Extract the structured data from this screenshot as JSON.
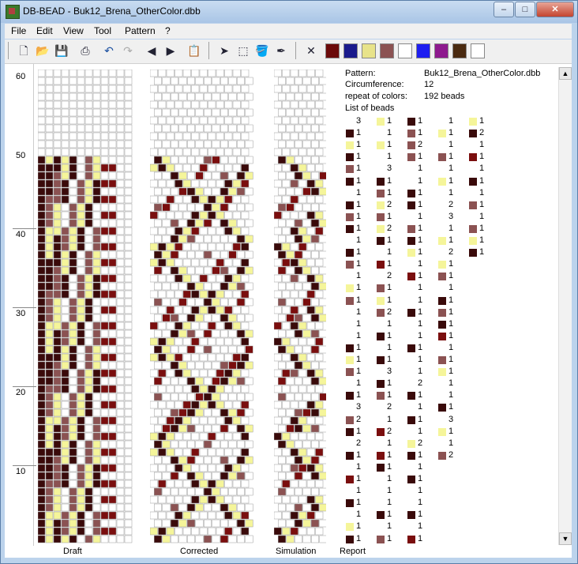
{
  "window": {
    "app": "DB-BEAD",
    "file": "Buk12_Brena_OtherColor.dbb",
    "title": "DB-BEAD - Buk12_Brena_OtherColor.dbb"
  },
  "menu": [
    "File",
    "Edit",
    "View",
    "Tool",
    "Pattern",
    "?"
  ],
  "toolbar_icons": [
    "new-file-icon",
    "open-folder-icon",
    "save-icon",
    "print-icon",
    "undo-icon",
    "redo-icon",
    "arrow-left-icon",
    "arrow-right-icon",
    "paste-icon",
    "pointer-icon",
    "select-rect-icon",
    "fill-icon",
    "eyedropper-icon",
    "clear-x-icon"
  ],
  "palette": [
    "#6b0a0a",
    "#1a1a8c",
    "#e8e38a",
    "#8b5252",
    "#ffffff",
    "#1e1ef0",
    "#8e1a8e",
    "#4a2a10",
    "#ffffff"
  ],
  "axis_labels": [
    "60",
    "50",
    "40",
    "30",
    "20",
    "10"
  ],
  "panels": [
    "Draft",
    "Corrected",
    "Simulation",
    "Report"
  ],
  "report": {
    "pattern_label": "Pattern:",
    "pattern_value": "Buk12_Brena_OtherColor.dbb",
    "circ_label": "Circumference:",
    "circ_value": "12",
    "repeat_label": "repeat of colors:",
    "repeat_value": "192 beads",
    "list_label": "List of beads"
  },
  "bead_colors": {
    "d": "#3a0a0a",
    "m": "#8b5252",
    "y": "#f5f59a",
    "w": "#ffffff",
    "r": "#7a0e0e"
  },
  "bead_list": [
    [
      [
        "w",
        "3"
      ],
      [
        "d",
        "1"
      ],
      [
        "y",
        "1"
      ],
      [
        "d",
        "1"
      ],
      [
        "m",
        "1"
      ],
      [
        "d",
        "1"
      ],
      [
        "w",
        "1"
      ],
      [
        "d",
        "1"
      ],
      [
        "m",
        "1"
      ],
      [
        "d",
        "1"
      ],
      [
        "w",
        "1"
      ],
      [
        "d",
        "1"
      ],
      [
        "m",
        "1"
      ],
      [
        "w",
        "1"
      ],
      [
        "y",
        "1"
      ],
      [
        "m",
        "1"
      ],
      [
        "w",
        "1"
      ],
      [
        "w",
        "1"
      ],
      [
        "w",
        "1"
      ],
      [
        "d",
        "1"
      ],
      [
        "y",
        "1"
      ],
      [
        "m",
        "1"
      ],
      [
        "w",
        "1"
      ],
      [
        "d",
        "1"
      ],
      [
        "w",
        "3"
      ],
      [
        "m",
        "2"
      ],
      [
        "d",
        "1"
      ],
      [
        "w",
        "2"
      ],
      [
        "d",
        "1"
      ],
      [
        "w",
        "1"
      ],
      [
        "r",
        "1"
      ],
      [
        "w",
        "1"
      ],
      [
        "d",
        "1"
      ],
      [
        "w",
        "1"
      ],
      [
        "y",
        "1"
      ],
      [
        "d",
        "1"
      ]
    ],
    [
      [
        "y",
        "1"
      ],
      [
        "w",
        "1"
      ],
      [
        "y",
        "1"
      ],
      [
        "w",
        "1"
      ],
      [
        "w",
        "3"
      ],
      [
        "d",
        "1"
      ],
      [
        "m",
        "1"
      ],
      [
        "y",
        "2"
      ],
      [
        "m",
        "1"
      ],
      [
        "y",
        "2"
      ],
      [
        "d",
        "1"
      ],
      [
        "w",
        "1"
      ],
      [
        "r",
        "1"
      ],
      [
        "w",
        "2"
      ],
      [
        "m",
        "1"
      ],
      [
        "y",
        "1"
      ],
      [
        "m",
        "2"
      ],
      [
        "w",
        "1"
      ],
      [
        "d",
        "1"
      ],
      [
        "w",
        "1"
      ],
      [
        "d",
        "1"
      ],
      [
        "w",
        "3"
      ],
      [
        "d",
        "1"
      ],
      [
        "m",
        "1"
      ],
      [
        "w",
        "2"
      ],
      [
        "w",
        "1"
      ],
      [
        "r",
        "2"
      ],
      [
        "w",
        "1"
      ],
      [
        "r",
        "1"
      ],
      [
        "d",
        "1"
      ],
      [
        "w",
        "1"
      ],
      [
        "w",
        "1"
      ],
      [
        "w",
        "1"
      ],
      [
        "d",
        "1"
      ],
      [
        "w",
        "1"
      ],
      [
        "m",
        "1"
      ]
    ],
    [
      [
        "d",
        "1"
      ],
      [
        "m",
        "1"
      ],
      [
        "m",
        "2"
      ],
      [
        "m",
        "1"
      ],
      [
        "w",
        "1"
      ],
      [
        "w",
        "1"
      ],
      [
        "d",
        "1"
      ],
      [
        "d",
        "1"
      ],
      [
        "w",
        "1"
      ],
      [
        "m",
        "1"
      ],
      [
        "d",
        "1"
      ],
      [
        "y",
        "1"
      ],
      [
        "w",
        "1"
      ],
      [
        "r",
        "1"
      ],
      [
        "w",
        "1"
      ],
      [
        "w",
        "1"
      ],
      [
        "d",
        "1"
      ],
      [
        "w",
        "1"
      ],
      [
        "w",
        "1"
      ],
      [
        "d",
        "1"
      ],
      [
        "w",
        "1"
      ],
      [
        "w",
        "1"
      ],
      [
        "w",
        "2"
      ],
      [
        "d",
        "1"
      ],
      [
        "w",
        "1"
      ],
      [
        "d",
        "1"
      ],
      [
        "w",
        "1"
      ],
      [
        "y",
        "2"
      ],
      [
        "d",
        "1"
      ],
      [
        "w",
        "1"
      ],
      [
        "d",
        "1"
      ],
      [
        "w",
        "1"
      ],
      [
        "w",
        "1"
      ],
      [
        "d",
        "1"
      ],
      [
        "w",
        "1"
      ],
      [
        "r",
        "1"
      ]
    ],
    [
      [
        "w",
        "1"
      ],
      [
        "y",
        "1"
      ],
      [
        "w",
        "1"
      ],
      [
        "m",
        "1"
      ],
      [
        "w",
        "1"
      ],
      [
        "y",
        "1"
      ],
      [
        "w",
        "1"
      ],
      [
        "w",
        "2"
      ],
      [
        "w",
        "3"
      ],
      [
        "w",
        "1"
      ],
      [
        "y",
        "1"
      ],
      [
        "w",
        "2"
      ],
      [
        "y",
        "1"
      ],
      [
        "m",
        "1"
      ],
      [
        "w",
        "1"
      ],
      [
        "d",
        "1"
      ],
      [
        "m",
        "1"
      ],
      [
        "d",
        "1"
      ],
      [
        "r",
        "1"
      ],
      [
        "w",
        "1"
      ],
      [
        "m",
        "1"
      ],
      [
        "y",
        "1"
      ],
      [
        "w",
        "1"
      ],
      [
        "w",
        "1"
      ],
      [
        "d",
        "1"
      ],
      [
        "w",
        "3"
      ],
      [
        "y",
        "1"
      ],
      [
        "w",
        "1"
      ],
      [
        "m",
        "2"
      ]
    ],
    [
      [
        "y",
        "1"
      ],
      [
        "d",
        "2"
      ],
      [
        "w",
        "1"
      ],
      [
        "r",
        "1"
      ],
      [
        "w",
        "1"
      ],
      [
        "d",
        "1"
      ],
      [
        "w",
        "1"
      ],
      [
        "m",
        "1"
      ],
      [
        "w",
        "1"
      ],
      [
        "m",
        "1"
      ],
      [
        "y",
        "1"
      ],
      [
        "d",
        "1"
      ]
    ]
  ]
}
